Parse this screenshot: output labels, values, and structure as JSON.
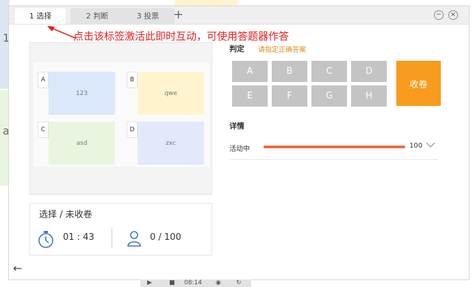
{
  "background": {
    "peek_chars": [
      "1",
      "a"
    ]
  },
  "tabs": [
    {
      "label": "1 选择"
    },
    {
      "label": "2 判断"
    },
    {
      "label": "3 投票"
    }
  ],
  "annotation_text": "点击该标签激活此即时互动，可使用答题器作答",
  "preview": {
    "options": [
      {
        "letter": "A",
        "text": "123",
        "color": "#dbe8fb"
      },
      {
        "letter": "B",
        "text": "qwe",
        "color": "#fff4cf"
      },
      {
        "letter": "C",
        "text": "asd",
        "color": "#eaf5e0"
      },
      {
        "letter": "D",
        "text": "zxc",
        "color": "#e3e8fb"
      }
    ]
  },
  "status": {
    "title": "选择 / 未收卷",
    "timer": "01 : 43",
    "count": "0 / 100"
  },
  "judge": {
    "label": "判定",
    "hint": "请指定正确答案",
    "options": [
      "A",
      "B",
      "C",
      "D",
      "E",
      "F",
      "G",
      "H"
    ],
    "collect_label": "收卷"
  },
  "details": {
    "label": "详情",
    "activity_label": "活动中",
    "value": "100",
    "progress_fraction": 1.0
  },
  "colors": {
    "accent_orange": "#f99b1c",
    "progress": "#f36a3b",
    "hint": "#e58e1a",
    "annotation": "#e81e1e"
  },
  "bottom_bar": {
    "time": "08:14"
  }
}
